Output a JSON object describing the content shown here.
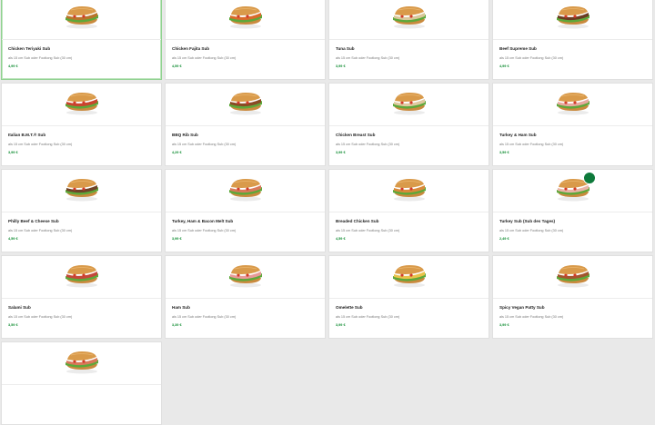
{
  "colors": {
    "page_bg": "#e9e9e9",
    "card_bg": "#ffffff",
    "price_green": "#0b8a2e",
    "selected_border": "#8fd18f"
  },
  "products": [
    {
      "name": "Chicken Teriyaki Sub",
      "desc": "als 15 cm Sub oder Footlong Sub (30 cm)",
      "price": "4,99 €",
      "filling": "#b8742b",
      "selected": true
    },
    {
      "name": "Chicken Fajita Sub",
      "desc": "als 15 cm Sub oder Footlong Sub (30 cm)",
      "price": "4,59 €",
      "filling": "#d96b2b"
    },
    {
      "name": "Tuna Sub",
      "desc": "als 15 cm Sub oder Footlong Sub (30 cm)",
      "price": "3,99 €",
      "filling": "#d9c79a"
    },
    {
      "name": "Beef Supreme Sub",
      "desc": "als 15 cm Sub oder Footlong Sub (30 cm)",
      "price": "4,99 €",
      "filling": "#6b3b22"
    },
    {
      "name": "Italian B.M.T.® Sub",
      "desc": "als 15 cm Sub oder Footlong Sub (30 cm)",
      "price": "3,99 €",
      "filling": "#c9452e"
    },
    {
      "name": "BBQ Rib Sub",
      "desc": "als 15 cm Sub oder Footlong Sub (30 cm)",
      "price": "4,29 €",
      "filling": "#8a4a24"
    },
    {
      "name": "Chicken Breast Sub",
      "desc": "als 15 cm Sub oder Footlong Sub (30 cm)",
      "price": "3,99 €",
      "filling": "#e0c9a0"
    },
    {
      "name": "Turkey & Ham Sub",
      "desc": "als 15 cm Sub oder Footlong Sub (30 cm)",
      "price": "3,59 €",
      "filling": "#e8a9a0"
    },
    {
      "name": "Philly Beef & Cheese Sub",
      "desc": "als 15 cm Sub oder Footlong Sub (30 cm)",
      "price": "4,59 €",
      "filling": "#6f4328"
    },
    {
      "name": "Turkey, Ham & Bacon Melt Sub",
      "desc": "als 15 cm Sub oder Footlong Sub (30 cm)",
      "price": "3,99 €",
      "filling": "#d9795a"
    },
    {
      "name": "Breaded Chicken Sub",
      "desc": "als 15 cm Sub oder Footlong Sub (30 cm)",
      "price": "4,59 €",
      "filling": "#d98a3a"
    },
    {
      "name": "Turkey Sub (Sub des Tages)",
      "desc": "als 15 cm Sub oder Footlong Sub (30 cm)",
      "price": "2,49 €",
      "filling": "#eab3a6",
      "badge": true
    },
    {
      "name": "Salami Sub",
      "desc": "als 15 cm Sub oder Footlong Sub (30 cm)",
      "price": "3,59 €",
      "filling": "#c4483a"
    },
    {
      "name": "Ham Sub",
      "desc": "als 15 cm Sub oder Footlong Sub (30 cm)",
      "price": "3,39 €",
      "filling": "#e89a98"
    },
    {
      "name": "Omelette Sub",
      "desc": "als 15 cm Sub oder Footlong Sub (30 cm)",
      "price": "3,99 €",
      "filling": "#e8c24a"
    },
    {
      "name": "Spicy Vegan Patty Sub",
      "desc": "als 15 cm Sub oder Footlong Sub (30 cm)",
      "price": "3,99 €",
      "filling": "#a2552e"
    },
    {
      "name": "",
      "desc": "",
      "price": "",
      "filling": "#d9795a"
    }
  ]
}
